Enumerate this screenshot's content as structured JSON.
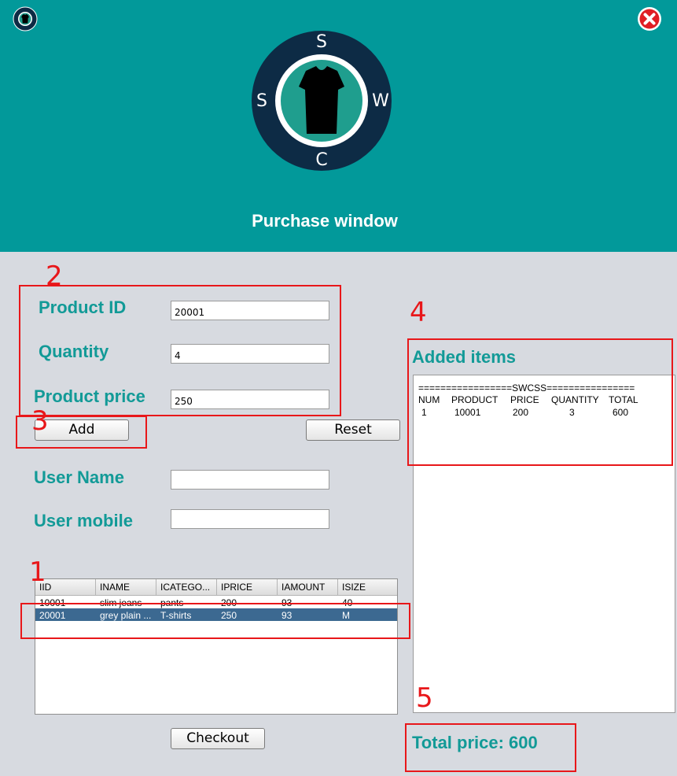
{
  "window": {
    "title": "Purchase window",
    "header_color": "#02999a",
    "app_icon": "shirt-logo-icon",
    "close_icon": "close-icon"
  },
  "logo": {
    "letters": {
      "top": "S",
      "left": "S",
      "right": "W",
      "bottom": "C"
    },
    "icon": "shirt-icon"
  },
  "form": {
    "product_id_label": "Product ID",
    "product_id_value": "20001",
    "quantity_label": "Quantity",
    "quantity_value": "4",
    "price_label": "Product price",
    "price_value": "250",
    "add_button": "Add",
    "reset_button": "Reset",
    "username_label": "User Name",
    "username_value": "",
    "mobile_label": "User mobile",
    "mobile_value": ""
  },
  "table": {
    "columns": [
      "IID",
      "INAME",
      "ICATEGO...",
      "IPRICE",
      "IAMOUNT",
      "ISIZE"
    ],
    "rows": [
      [
        "10001",
        "slim jeans",
        "pants",
        "200",
        "93",
        "40"
      ],
      [
        "20001",
        "grey plain ...",
        "T-shirts",
        "250",
        "93",
        "M"
      ]
    ],
    "selected_row": 1
  },
  "checkout_button": "Checkout",
  "receipt": {
    "title": "Added items",
    "banner": "=================SWCSS================",
    "header": [
      "NUM",
      "PRODUCT",
      "PRICE",
      "QUANTITY",
      "TOTAL"
    ],
    "items": [
      [
        "1",
        "10001",
        "200",
        "3",
        "600"
      ]
    ]
  },
  "total_price": "Total price: 600",
  "annotations": {
    "color": "#e8171a",
    "labels": [
      "1",
      "2",
      "3",
      "4",
      "5"
    ]
  }
}
